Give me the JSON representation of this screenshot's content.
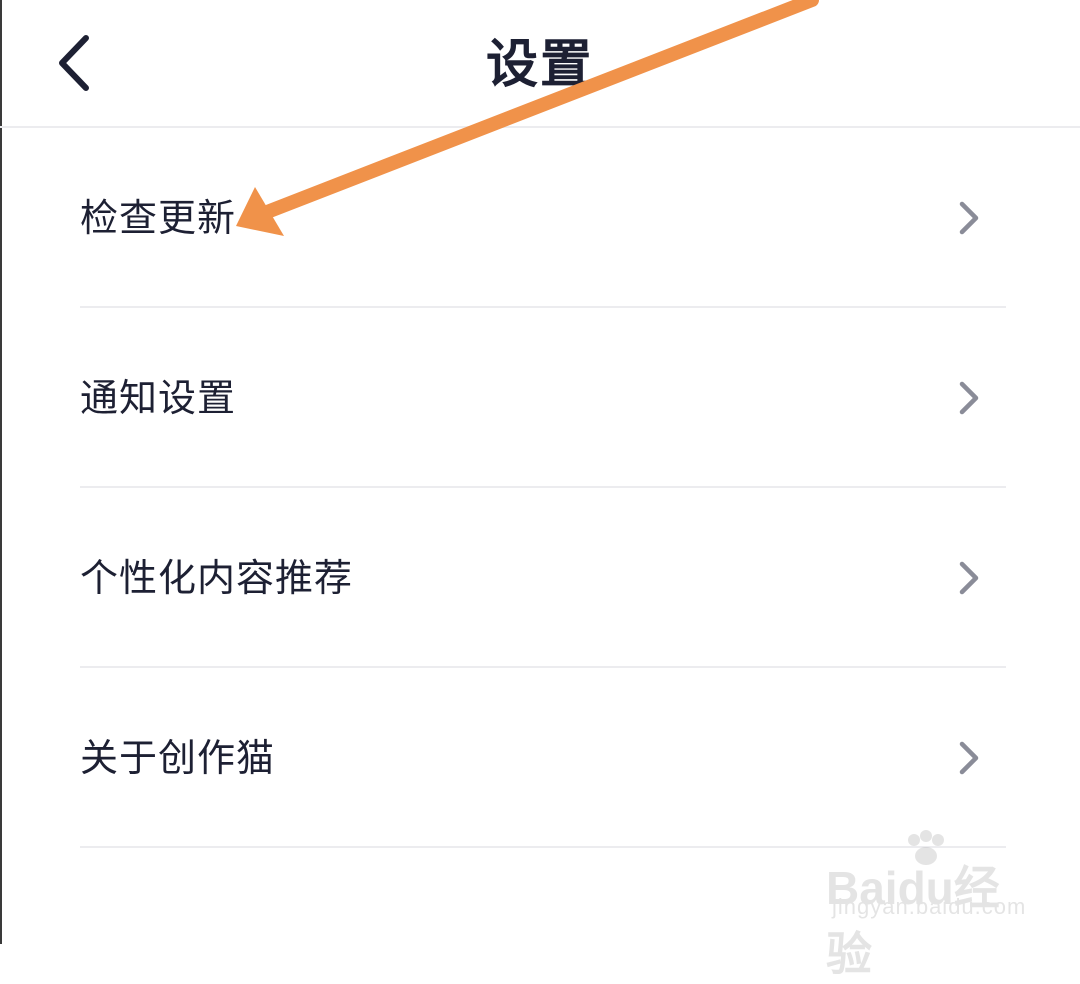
{
  "header": {
    "title": "设置",
    "back_icon": "chevron-left-icon"
  },
  "menu": {
    "items": [
      {
        "label": "检查更新",
        "icon": "chevron-right-icon"
      },
      {
        "label": "通知设置",
        "icon": "chevron-right-icon"
      },
      {
        "label": "个性化内容推荐",
        "icon": "chevron-right-icon"
      },
      {
        "label": "关于创作猫",
        "icon": "chevron-right-icon"
      }
    ]
  },
  "annotation": {
    "arrow_color": "#f0924a",
    "target": "检查更新"
  },
  "watermark": {
    "logo_text": "Baidu经验",
    "url_text": "jingyan.baidu.com"
  },
  "colors": {
    "text": "#1d2033",
    "chevron": "#8a8c98",
    "divider": "#ececef",
    "background": "#ffffff"
  }
}
